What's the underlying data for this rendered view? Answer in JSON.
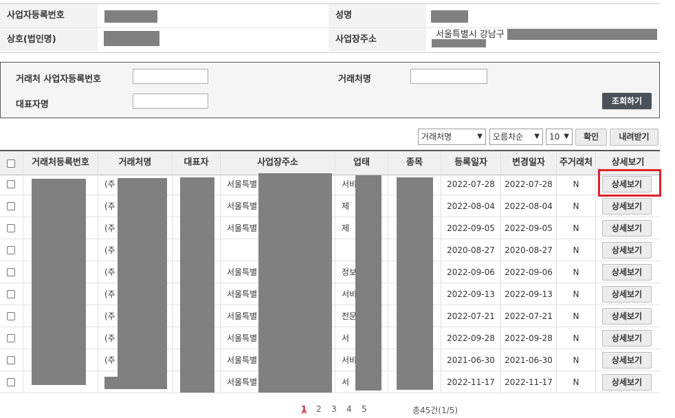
{
  "info": {
    "biz_no_label": "사업자등록번호",
    "name_label": "성명",
    "company_label": "상호(법인명)",
    "address_label": "사업장주소",
    "address_value": "서울특별시 강남구"
  },
  "search": {
    "client_biz_no_label": "거래처 사업자등록번호",
    "client_name_label": "거래처명",
    "rep_name_label": "대표자명",
    "search_button": "조회하기"
  },
  "toolbar": {
    "sort_field": "거래처명",
    "sort_order": "오름차순",
    "page_size": "10",
    "confirm_button": "확인",
    "download_button": "내려받기"
  },
  "table": {
    "headers": [
      "거래처등록번호",
      "거래처명",
      "대표자",
      "사업장주소",
      "업태",
      "종목",
      "등록일자",
      "변경일자",
      "주거래처",
      "상세보기"
    ],
    "rows": [
      {
        "name": "(주",
        "addr": "서울특별",
        "biz": "서비",
        "reg": "2022-07-28",
        "mod": "2022-07-28",
        "main": "N",
        "detail": "상세보기"
      },
      {
        "name": "(주",
        "addr": "서울특별",
        "biz": "제",
        "reg": "2022-08-04",
        "mod": "2022-08-04",
        "main": "N",
        "detail": "상세보기"
      },
      {
        "name": "(주",
        "addr": "서울특별",
        "biz": "제",
        "reg": "2022-09-05",
        "mod": "2022-09-05",
        "main": "N",
        "detail": "상세보기"
      },
      {
        "name": "(주",
        "addr": "",
        "biz": "",
        "reg": "2020-08-27",
        "mod": "2020-08-27",
        "main": "N",
        "detail": "상세보기"
      },
      {
        "name": "(주",
        "addr": "서울특별",
        "biz": "정보",
        "reg": "2022-09-06",
        "mod": "2022-09-06",
        "main": "N",
        "detail": "상세보기"
      },
      {
        "name": "(주",
        "addr": "서울특별",
        "biz": "서비",
        "reg": "2022-09-13",
        "mod": "2022-09-13",
        "main": "N",
        "detail": "상세보기"
      },
      {
        "name": "(주",
        "addr": "서울특별",
        "biz": "전문",
        "reg": "2022-07-21",
        "mod": "2022-07-21",
        "main": "N",
        "detail": "상세보기"
      },
      {
        "name": "(주",
        "addr": "서울특별",
        "biz": "서",
        "reg": "2022-09-28",
        "mod": "2022-09-28",
        "main": "N",
        "detail": "상세보기"
      },
      {
        "name": "(주",
        "addr": "서울특별",
        "biz": "서비",
        "reg": "2021-06-30",
        "mod": "2021-06-30",
        "main": "N",
        "detail": "상세보기"
      },
      {
        "name": "",
        "addr": "서울특별",
        "biz": "서",
        "reg": "2022-11-17",
        "mod": "2022-11-17",
        "main": "N",
        "detail": "상세보기"
      }
    ]
  },
  "pagination": {
    "pages": [
      "1",
      "2",
      "3",
      "4",
      "5"
    ],
    "total": "총45건(1/5)"
  },
  "colors": {
    "highlight": "#e0202a",
    "mask": "#808080",
    "dark_button": "#4a5159"
  }
}
